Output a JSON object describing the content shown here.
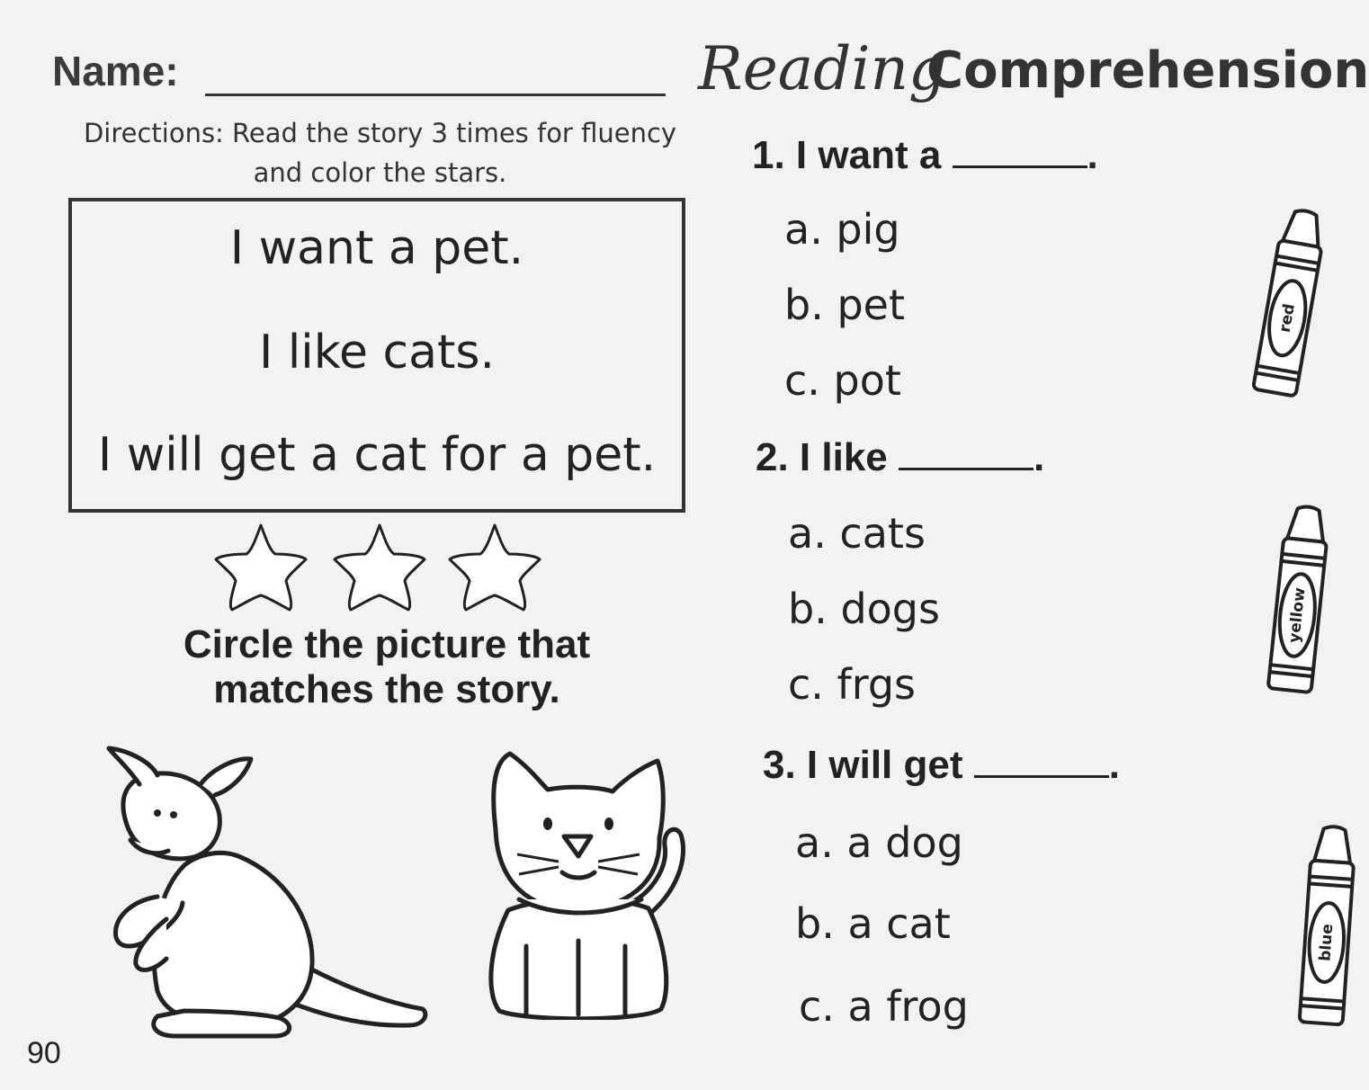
{
  "header": {
    "name_label": "Name:",
    "title_script": "Reading",
    "title_bold": "Comprehension"
  },
  "directions": {
    "line1": "Directions: Read the story 3 times for fluency",
    "line2": "and color the stars."
  },
  "story": {
    "lines": [
      "I want a pet.",
      "I like cats.",
      "I will get a cat for a pet."
    ]
  },
  "circle_instruction": {
    "line1": "Circle the picture that",
    "line2": "matches the story."
  },
  "questions": [
    {
      "prompt": "1. I want a",
      "end": ".",
      "options": [
        "a. pig",
        "b. pet",
        "c. pot"
      ],
      "crayon_label": "red"
    },
    {
      "prompt": "2. I like",
      "end": ".",
      "options": [
        "a. cats",
        "b. dogs",
        "c. frgs"
      ],
      "crayon_label": "yellow"
    },
    {
      "prompt": "3. I will get",
      "end": ".",
      "options": [
        "a. a dog",
        "b. a cat",
        "c. a frog"
      ],
      "crayon_label": "blue"
    }
  ],
  "page_number": "90"
}
